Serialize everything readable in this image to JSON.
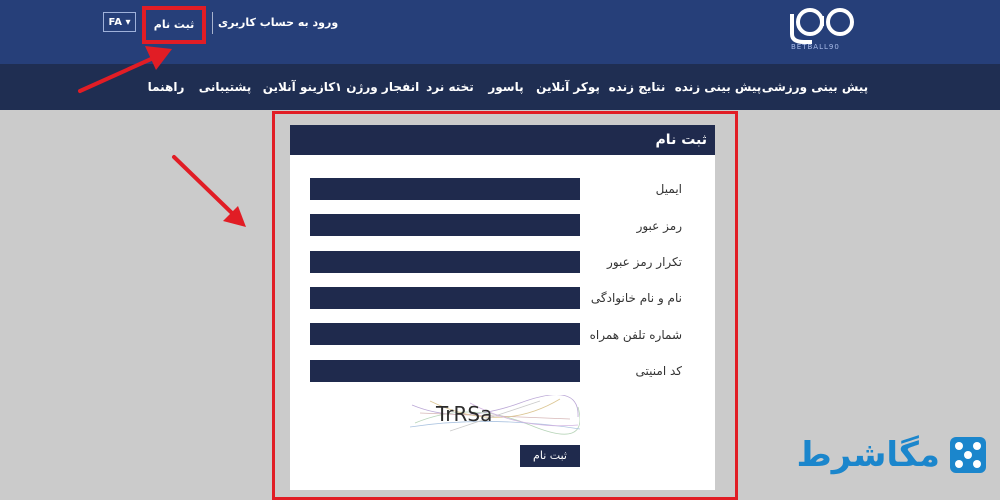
{
  "header": {
    "lang": "FA",
    "signup": "ثبت نام",
    "login": "ورود به حساب کاربری",
    "logo_text": "BETBALL90"
  },
  "nav": {
    "items": [
      "پیش بینی ورزشی",
      "پیش بینی زنده",
      "نتایج زنده",
      "پوکر آنلاین",
      "پاسور",
      "تخته نرد",
      "انفجار ورژن ۱",
      "کازینو آنلاین",
      "پشتیبانی",
      "راهنما"
    ]
  },
  "form": {
    "title": "ثبت نام",
    "labels": {
      "email": "ایمیل",
      "password": "رمز عبور",
      "confirm": "تکرار رمز عبور",
      "fullname": "نام و نام خانوادگی",
      "phone": "شماره تلفن همراه",
      "security": "کد امنیتی"
    },
    "captcha": "TrRSa",
    "submit": "ثبت نام"
  },
  "watermark": {
    "text": "مگاشرط"
  },
  "colors": {
    "header": "#263f79",
    "nav": "#1f2e52",
    "field": "#1f2a4d",
    "highlight": "#e11d25",
    "watermark": "#1b86cc"
  }
}
